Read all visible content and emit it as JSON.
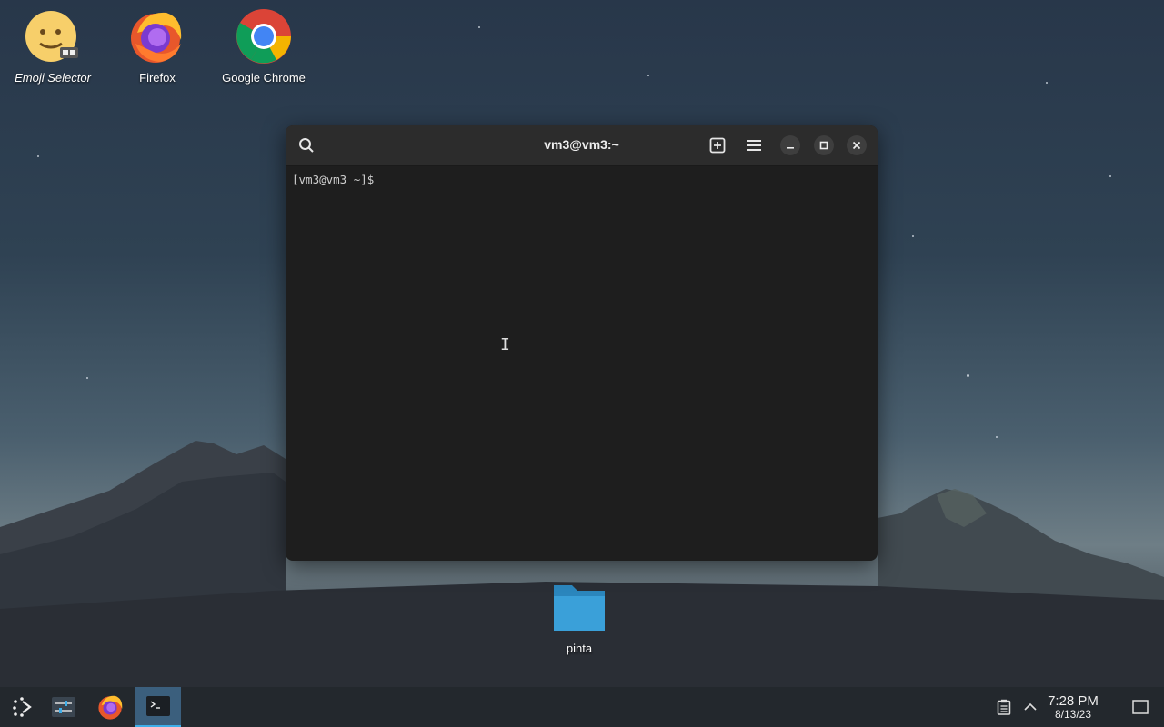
{
  "desktop": {
    "icons": [
      {
        "label": "Emoji Selector",
        "icon": "emoji-face-icon"
      },
      {
        "label": "Firefox",
        "icon": "firefox-icon"
      },
      {
        "label": "Google Chrome",
        "icon": "chrome-icon"
      }
    ],
    "folder": {
      "label": "pinta",
      "icon": "folder-icon"
    }
  },
  "terminal": {
    "title": "vm3@vm3:~",
    "prompt": "[vm3@vm3 ~]$",
    "buttons": [
      "search-icon",
      "new-tab-icon",
      "hamburger-menu-icon",
      "minimize-icon",
      "maximize-icon",
      "close-icon"
    ]
  },
  "taskbar": {
    "items": [
      "app-launcher-icon",
      "settings-sliders-icon",
      "firefox-icon",
      "terminal-icon"
    ],
    "active_item": "terminal-icon",
    "tray": [
      "clipboard-icon",
      "chevron-up-icon"
    ],
    "time": "7:28 PM",
    "date": "8/13/23",
    "show_desktop": "show-desktop-icon"
  },
  "colors": {
    "accent": "#3daee9",
    "taskbar_bg": "#23282d",
    "terminal_bg": "#1e1e1e",
    "titlebar_bg": "#2c2c2c",
    "folder": "#3aa0d9"
  }
}
